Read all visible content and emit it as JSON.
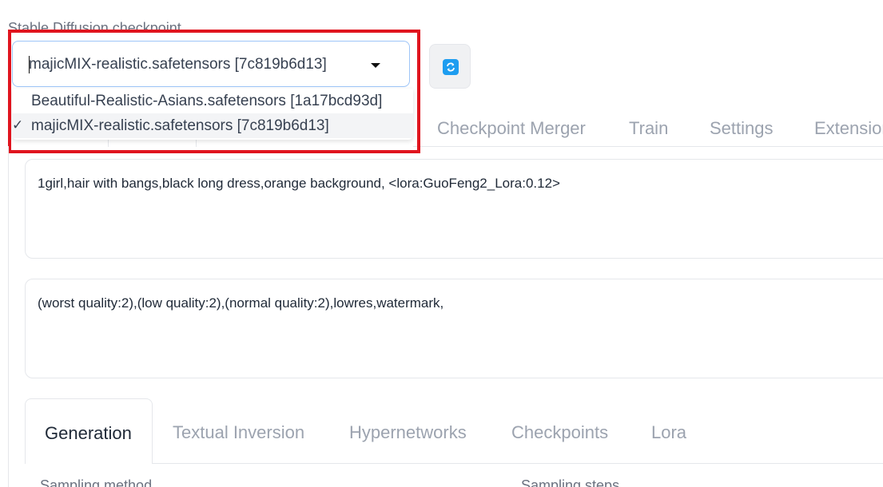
{
  "checkpoint": {
    "label": "Stable Diffusion checkpoint",
    "selected": "majicMIX-realistic.safetensors [7c819b6d13]",
    "options": [
      {
        "label": "Beautiful-Realistic-Asians.safetensors [1a17bcd93d]",
        "selected": false
      },
      {
        "label": "majicMIX-realistic.safetensors [7c819b6d13]",
        "selected": true
      }
    ],
    "check_mark": "✓",
    "refresh_icon": "refresh-icon"
  },
  "top_tabs": [
    "Checkpoint Merger",
    "Train",
    "Settings",
    "Extensions"
  ],
  "prompt": "1girl,hair with bangs,black long dress,orange background, <lora:GuoFeng2_Lora:0.12>",
  "negative_prompt": "(worst quality:2),(low quality:2),(normal quality:2),lowres,watermark,",
  "bottom_tabs": [
    "Generation",
    "Textual Inversion",
    "Hypernetworks",
    "Checkpoints",
    "Lora"
  ],
  "settings_labels": {
    "sampling_method": "Sampling method",
    "sampling_steps": "Sampling steps"
  },
  "colors": {
    "highlight": "#e0141e",
    "accent": "#1e9df0"
  }
}
